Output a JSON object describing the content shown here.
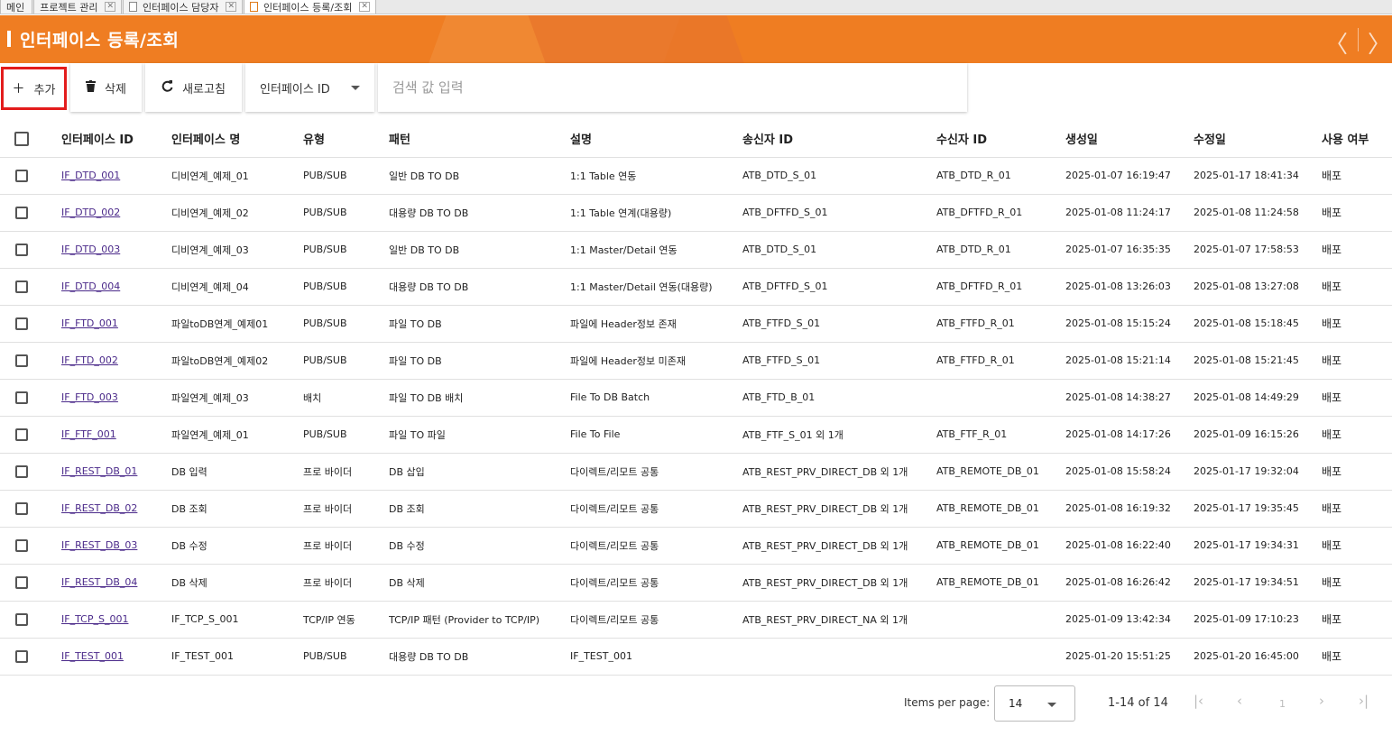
{
  "tabs": [
    {
      "label": "메인",
      "icon": "none",
      "active": false
    },
    {
      "label": "프로젝트 관리",
      "icon": "none",
      "active": false
    },
    {
      "label": "인터페이스 담당자",
      "icon": "document-icon",
      "active": false
    },
    {
      "label": "인터페이스 등록/조회",
      "icon": "document-icon",
      "active": true
    }
  ],
  "header": {
    "title": "인터페이스 등록/조회",
    "prev_glyph": "〈",
    "next_glyph": "〉",
    "background_color": "#ef7d22"
  },
  "toolbar": {
    "add_label": "추가",
    "delete_label": "삭제",
    "refresh_label": "새로고침",
    "search_field_selected": "인터페이스 ID",
    "search_placeholder": "검색 값 입력",
    "highlight_color": "#e31c1c"
  },
  "table": {
    "columns": [
      "인터페이스 ID",
      "인터페이스 명",
      "유형",
      "패턴",
      "설명",
      "송신자 ID",
      "수신자 ID",
      "생성일",
      "수정일",
      "사용 여부"
    ],
    "rows": [
      [
        "IF_DTD_001",
        "디비연계_예제_01",
        "PUB/SUB",
        "일반 DB TO DB",
        "1:1 Table 연동",
        "ATB_DTD_S_01",
        "ATB_DTD_R_01",
        "2025-01-07 16:19:47",
        "2025-01-17 18:41:34",
        "배포"
      ],
      [
        "IF_DTD_002",
        "디비연계_예제_02",
        "PUB/SUB",
        "대용량 DB TO DB",
        "1:1 Table 연계(대용량)",
        "ATB_DFTFD_S_01",
        "ATB_DFTFD_R_01",
        "2025-01-08 11:24:17",
        "2025-01-08 11:24:58",
        "배포"
      ],
      [
        "IF_DTD_003",
        "디비연계_예제_03",
        "PUB/SUB",
        "일반 DB TO DB",
        "1:1 Master/Detail 연동",
        "ATB_DTD_S_01",
        "ATB_DTD_R_01",
        "2025-01-07 16:35:35",
        "2025-01-07 17:58:53",
        "배포"
      ],
      [
        "IF_DTD_004",
        "디비연계_예제_04",
        "PUB/SUB",
        "대용량 DB TO DB",
        "1:1 Master/Detail 연동(대용량)",
        "ATB_DFTFD_S_01",
        "ATB_DFTFD_R_01",
        "2025-01-08 13:26:03",
        "2025-01-08 13:27:08",
        "배포"
      ],
      [
        "IF_FTD_001",
        "파일toDB연계_예제01",
        "PUB/SUB",
        "파일 TO DB",
        "파일에 Header정보 존재",
        "ATB_FTFD_S_01",
        "ATB_FTFD_R_01",
        "2025-01-08 15:15:24",
        "2025-01-08 15:18:45",
        "배포"
      ],
      [
        "IF_FTD_002",
        "파일toDB연계_예제02",
        "PUB/SUB",
        "파일 TO DB",
        "파일에 Header정보 미존재",
        "ATB_FTFD_S_01",
        "ATB_FTFD_R_01",
        "2025-01-08 15:21:14",
        "2025-01-08 15:21:45",
        "배포"
      ],
      [
        "IF_FTD_003",
        "파일연계_예제_03",
        "배치",
        "파일 TO DB 배치",
        "File To DB Batch",
        "ATB_FTD_B_01",
        "",
        "2025-01-08 14:38:27",
        "2025-01-08 14:49:29",
        "배포"
      ],
      [
        "IF_FTF_001",
        "파일연계_예제_01",
        "PUB/SUB",
        "파일 TO 파일",
        "File To File",
        "ATB_FTF_S_01 외 1개",
        "ATB_FTF_R_01",
        "2025-01-08 14:17:26",
        "2025-01-09 16:15:26",
        "배포"
      ],
      [
        "IF_REST_DB_01",
        "DB 입력",
        "프로 바이더",
        "DB 삽입",
        "다이렉트/리모트 공통",
        "ATB_REST_PRV_DIRECT_DB 외 1개",
        "ATB_REMOTE_DB_01",
        "2025-01-08 15:58:24",
        "2025-01-17 19:32:04",
        "배포"
      ],
      [
        "IF_REST_DB_02",
        "DB 조회",
        "프로 바이더",
        "DB 조회",
        "다이렉트/리모트 공통",
        "ATB_REST_PRV_DIRECT_DB 외 1개",
        "ATB_REMOTE_DB_01",
        "2025-01-08 16:19:32",
        "2025-01-17 19:35:45",
        "배포"
      ],
      [
        "IF_REST_DB_03",
        "DB 수정",
        "프로 바이더",
        "DB 수정",
        "다이렉트/리모트 공통",
        "ATB_REST_PRV_DIRECT_DB 외 1개",
        "ATB_REMOTE_DB_01",
        "2025-01-08 16:22:40",
        "2025-01-17 19:34:31",
        "배포"
      ],
      [
        "IF_REST_DB_04",
        "DB 삭제",
        "프로 바이더",
        "DB 삭제",
        "다이렉트/리모트 공통",
        "ATB_REST_PRV_DIRECT_DB 외 1개",
        "ATB_REMOTE_DB_01",
        "2025-01-08 16:26:42",
        "2025-01-17 19:34:51",
        "배포"
      ],
      [
        "IF_TCP_S_001",
        "IF_TCP_S_001",
        "TCP/IP 연동",
        "TCP/IP 패턴 (Provider to TCP/IP)",
        "다이렉트/리모트 공통",
        "ATB_REST_PRV_DIRECT_NA 외 1개",
        "",
        "2025-01-09 13:42:34",
        "2025-01-09 17:10:23",
        "배포"
      ],
      [
        "IF_TEST_001",
        "IF_TEST_001",
        "PUB/SUB",
        "대용량 DB TO DB",
        "IF_TEST_001",
        "",
        "",
        "2025-01-20 15:51:25",
        "2025-01-20 16:45:00",
        "배포"
      ]
    ]
  },
  "paginator": {
    "items_per_page_label": "Items per page:",
    "items_per_page_value": "14",
    "range_label": "1-14 of 14",
    "current_page": "1"
  }
}
